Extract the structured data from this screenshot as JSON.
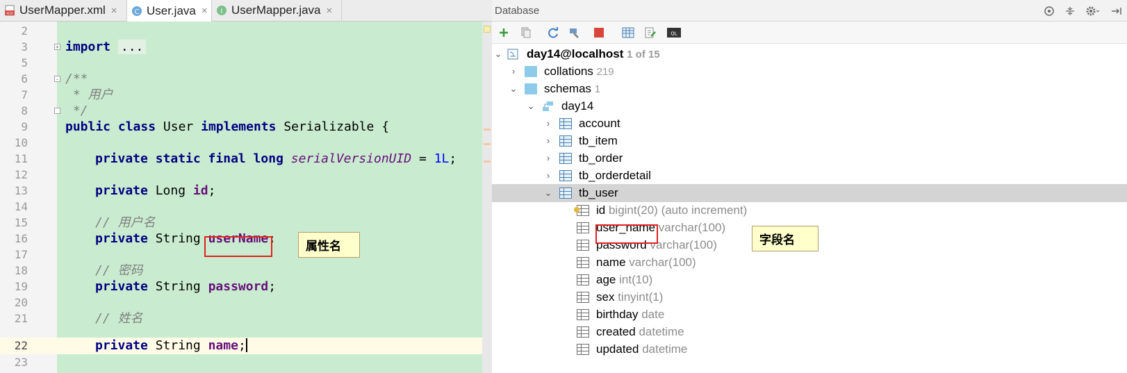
{
  "editor": {
    "tabs": [
      {
        "label": "UserMapper.xml",
        "icon": "xml-file-icon"
      },
      {
        "label": "User.java",
        "icon": "class-icon",
        "active": true
      },
      {
        "label": "UserMapper.java",
        "icon": "interface-icon"
      }
    ],
    "close_glyph": "×",
    "lines": [
      {
        "n": "2"
      },
      {
        "n": "3"
      },
      {
        "n": "5"
      },
      {
        "n": "6"
      },
      {
        "n": "7"
      },
      {
        "n": "8"
      },
      {
        "n": "9"
      },
      {
        "n": "10"
      },
      {
        "n": "11"
      },
      {
        "n": "12"
      },
      {
        "n": "13"
      },
      {
        "n": "14"
      },
      {
        "n": "15"
      },
      {
        "n": "16"
      },
      {
        "n": "17"
      },
      {
        "n": "18"
      },
      {
        "n": "19"
      },
      {
        "n": "20"
      },
      {
        "n": "21"
      },
      {
        "n": "22"
      },
      {
        "n": "23"
      }
    ],
    "code": {
      "import_kw": "import",
      "import_fold": "...",
      "javadoc_open": "/**",
      "javadoc_text": " * 用户",
      "javadoc_close": " */",
      "class_line": {
        "kw1": "public",
        "kw2": "class",
        "name": "User",
        "kw3": "implements",
        "iface": "Serializable",
        "brace": "{"
      },
      "serial_line": {
        "mods": "private static final long",
        "field": "serialVersionUID",
        "eq": " = ",
        "val": "1L",
        "end": ";"
      },
      "id_line": {
        "kw": "private",
        "type": "Long",
        "field": "id",
        "end": ";"
      },
      "c_username": "// 用户名",
      "username_line": {
        "kw": "private",
        "type": "String",
        "field": "userName",
        "end": ";"
      },
      "c_password": "// 密码",
      "password_line": {
        "kw": "private",
        "type": "String",
        "field": "password",
        "end": ";"
      },
      "c_name": "// 姓名",
      "name_line": {
        "kw": "private",
        "type": "String",
        "field": "name",
        "end": ";"
      }
    },
    "annotation": "属性名"
  },
  "database": {
    "title": "Database",
    "header_icons": [
      "target-icon",
      "collapse-icon",
      "gear-icon",
      "hide-icon"
    ],
    "toolbar_icons": [
      "add-icon",
      "copy-icon",
      "refresh-icon",
      "properties-icon",
      "stop-icon",
      "table-icon",
      "edit-icon",
      "console-icon"
    ],
    "console_label": "QL",
    "tree": {
      "root": {
        "label": "day14@localhost",
        "meta": "1 of 15"
      },
      "collations": {
        "label": "collations",
        "meta": "219"
      },
      "schemas": {
        "label": "schemas",
        "meta": "1"
      },
      "schema": {
        "label": "day14"
      },
      "tables": [
        "account",
        "tb_item",
        "tb_order",
        "tb_orderdetail",
        "tb_user"
      ],
      "columns": [
        {
          "name": "id",
          "type": "bigint(20) (auto increment)"
        },
        {
          "name": "user_name",
          "type": "varchar(100)"
        },
        {
          "name": "password",
          "type": "varchar(100)"
        },
        {
          "name": "name",
          "type": "varchar(100)"
        },
        {
          "name": "age",
          "type": "int(10)"
        },
        {
          "name": "sex",
          "type": "tinyint(1)"
        },
        {
          "name": "birthday",
          "type": "date"
        },
        {
          "name": "created",
          "type": "datetime"
        },
        {
          "name": "updated",
          "type": "datetime"
        }
      ]
    },
    "annotation": "字段名"
  }
}
